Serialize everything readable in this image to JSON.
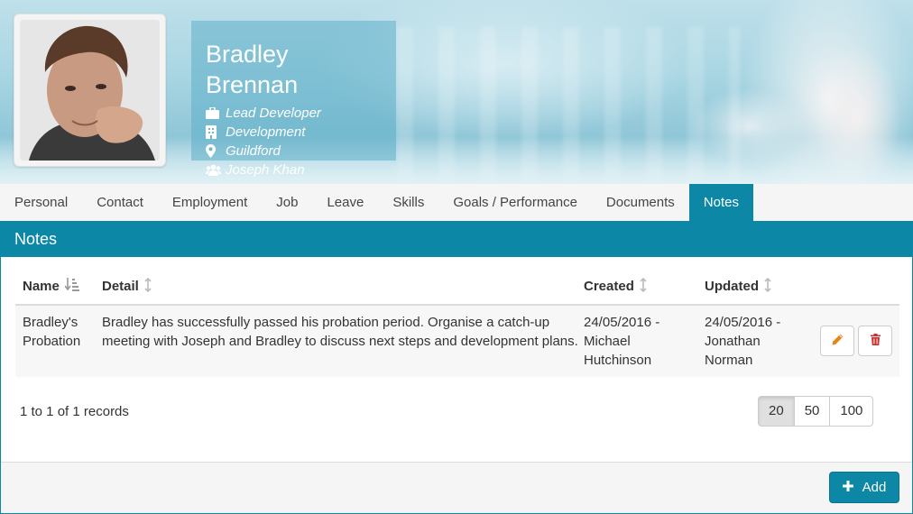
{
  "profile": {
    "name": "Bradley Brennan",
    "title": "Lead Developer",
    "department": "Development",
    "location": "Guildford",
    "manager": "Joseph Khan"
  },
  "tabs": [
    {
      "label": "Personal"
    },
    {
      "label": "Contact"
    },
    {
      "label": "Employment"
    },
    {
      "label": "Job"
    },
    {
      "label": "Leave"
    },
    {
      "label": "Skills"
    },
    {
      "label": "Goals / Performance"
    },
    {
      "label": "Documents"
    },
    {
      "label": "Notes",
      "active": true
    }
  ],
  "panel": {
    "title": "Notes"
  },
  "grid": {
    "columns": {
      "name": "Name",
      "detail": "Detail",
      "created": "Created",
      "updated": "Updated"
    },
    "rows": [
      {
        "name_line1": "Bradley's",
        "name_line2": "Probation",
        "detail_line1": "Bradley has successfully passed his probation period. Organise a catch-up",
        "detail_line2": "meeting with Joseph and Bradley to discuss next steps and development plans.",
        "created_line1": "24/05/2016 -",
        "created_line2": "Michael",
        "created_line3": "Hutchinson",
        "updated_line1": "24/05/2016 -",
        "updated_line2": "Jonathan",
        "updated_line3": "Norman"
      }
    ]
  },
  "records_text": "1 to 1 of 1 records",
  "page_sizes": [
    "20",
    "50",
    "100"
  ],
  "selected_page_size": "20",
  "add_button": "Add",
  "colors": {
    "accent": "#0c87a6",
    "edit_icon": "#e8841a",
    "delete_icon": "#c9302c"
  }
}
